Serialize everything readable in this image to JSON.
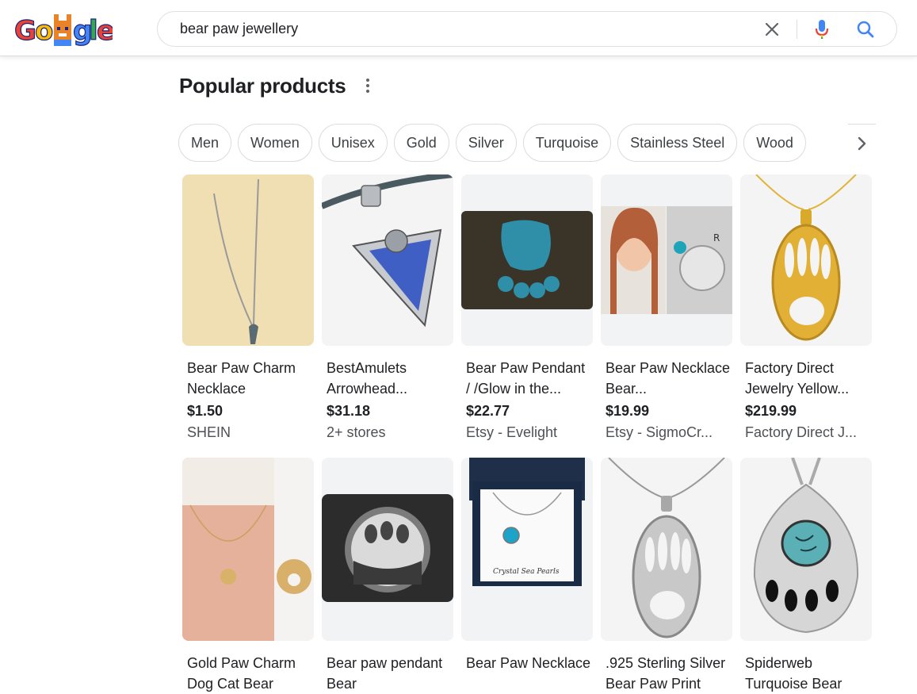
{
  "header": {
    "logo_alt": "Google",
    "search_value": "bear paw jewellery"
  },
  "section": {
    "title": "Popular products"
  },
  "chips": [
    "Men",
    "Women",
    "Unisex",
    "Gold",
    "Silver",
    "Turquoise",
    "Stainless Steel",
    "Wood"
  ],
  "products": [
    {
      "title": "Bear Paw Charm Necklace",
      "price": "$1.50",
      "store": "SHEIN"
    },
    {
      "title": "BestAmulets Arrowhead...",
      "price": "$31.18",
      "store": "2+ stores"
    },
    {
      "title": "Bear Paw Pendant / /Glow in the...",
      "price": "$22.77",
      "store": "Etsy - Evelight"
    },
    {
      "title": "Bear Paw Necklace Bear...",
      "price": "$19.99",
      "store": "Etsy - SigmoCr..."
    },
    {
      "title": "Factory Direct Jewelry Yellow...",
      "price": "$219.99",
      "store": "Factory Direct J..."
    },
    {
      "title": "Gold Paw Charm Dog Cat Bear",
      "price": "",
      "store": ""
    },
    {
      "title": "Bear paw pendant Bear",
      "price": "",
      "store": ""
    },
    {
      "title": "Bear Paw Necklace",
      "price": "",
      "store": ""
    },
    {
      "title": ".925 Sterling Silver Bear Paw Print",
      "price": "",
      "store": ""
    },
    {
      "title": "Spiderweb Turquoise Bear",
      "price": "",
      "store": ""
    }
  ],
  "image_text": {
    "box_brand": "Crystal Sea Pearls",
    "pendant_letter": "R"
  },
  "colors": {
    "google_blue": "#4285f4",
    "google_red": "#ea4335",
    "google_yellow": "#fbbc05",
    "google_green": "#34a853",
    "text_primary": "#202124",
    "text_secondary": "#4d5156",
    "chip_border": "#dadce0"
  },
  "icons": {
    "clear": "close-icon",
    "mic": "microphone-icon",
    "search": "search-icon",
    "more": "more-vert-icon",
    "next": "chevron-right-icon"
  }
}
